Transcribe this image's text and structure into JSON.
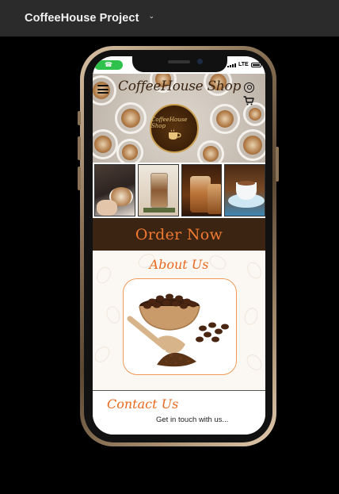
{
  "app": {
    "project_title": "CoffeeHouse Project"
  },
  "status_bar": {
    "network": "LTE"
  },
  "site": {
    "brand": "CoffeeHouse Shop",
    "logo_text": "CoffeeHouse Shop",
    "order_button": "Order Now",
    "about_title": "About Us",
    "contact_title": "Contact Us",
    "contact_subtitle": "Get in touch with us..."
  },
  "icons": {
    "menu": "hamburger-menu-icon",
    "user": "user-account-icon",
    "cart": "shopping-cart-icon",
    "dropdown": "chevron-down-icon",
    "call": "phone-call-icon"
  },
  "colors": {
    "topbar": "#2b2b2b",
    "accent_orange": "#f07a32",
    "order_band": "#3c2412",
    "call_pill": "#2ec24c"
  }
}
